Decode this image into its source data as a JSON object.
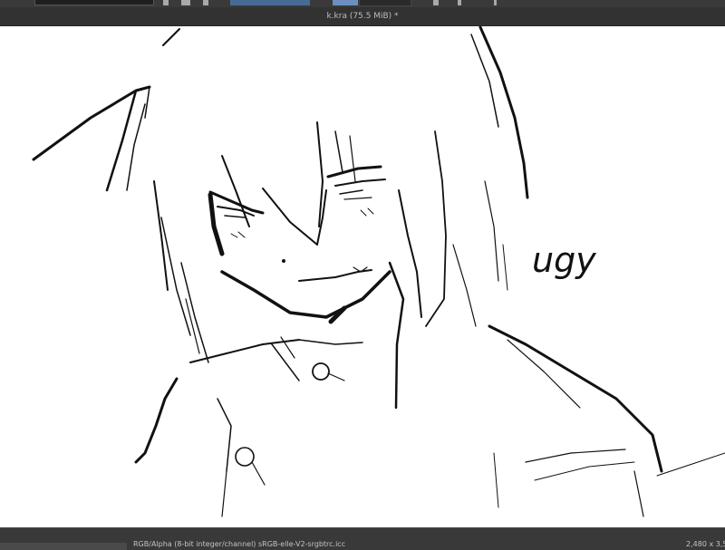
{
  "document": {
    "title": "k.kra (75.5 MiB) *"
  },
  "status": {
    "color_profile": "RGB/Alpha (8-bit integer/channel)  sRGB-elle-V2-srgbtrc.icc",
    "image_size": "2,480 x 3,50"
  },
  "canvas": {
    "background": "#ffffff",
    "ink": "#111111",
    "handwritten_text": "ugy"
  },
  "colors": {
    "accent": "#4a6a96",
    "ui_dark": "#2e2e2e"
  }
}
